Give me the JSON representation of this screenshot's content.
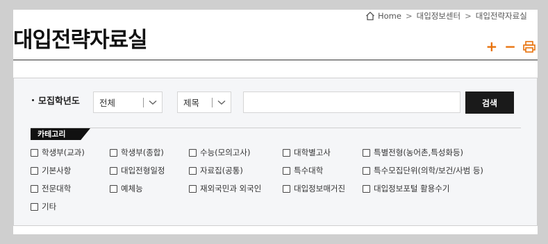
{
  "breadcrumb": {
    "home": "Home",
    "level1": "대입정보센터",
    "level2": "대입전략자료실",
    "separator": ">"
  },
  "page": {
    "title": "대입전략자료실"
  },
  "tools": {
    "zoom_in": "+",
    "zoom_out": "−"
  },
  "search": {
    "year_label": "모집학년도",
    "year_selected": "전체",
    "field_selected": "제목",
    "keyword_value": "",
    "button_label": "검색"
  },
  "category": {
    "label": "카테고리",
    "items": [
      [
        "학생부(교과)",
        "학생부(종합)",
        "수능(모의고사)",
        "대학별고사",
        "특별전형(농어촌,특성화등)"
      ],
      [
        "기본사항",
        "대입전형일정",
        "자료집(공통)",
        "특수대학",
        "특수모집단위(의학/보건/사범 등)"
      ],
      [
        "전문대학",
        "예체능",
        "재외국민과 외국인",
        "대입정보매거진",
        "대입정보포털 활용수기"
      ],
      [
        "기타"
      ]
    ]
  },
  "colors": {
    "accent": "#e8720c",
    "dark": "#1a1a1a"
  }
}
